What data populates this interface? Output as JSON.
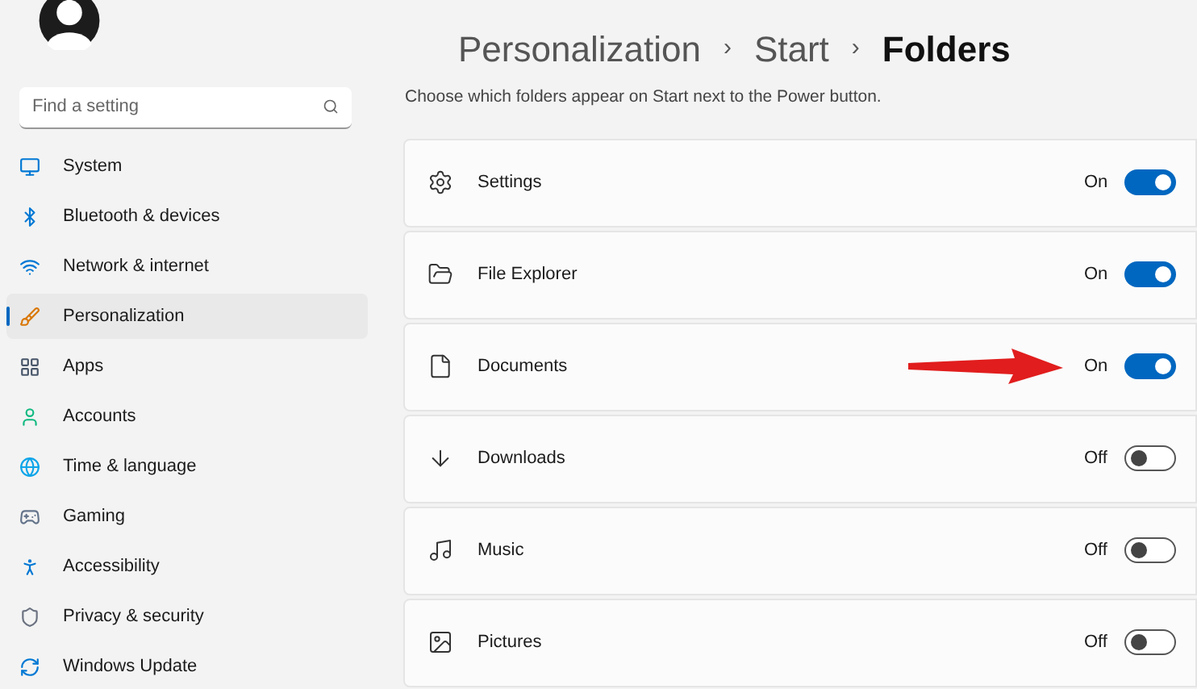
{
  "search": {
    "placeholder": "Find a setting"
  },
  "nav": [
    {
      "label": "System",
      "selected": false
    },
    {
      "label": "Bluetooth & devices",
      "selected": false
    },
    {
      "label": "Network & internet",
      "selected": false
    },
    {
      "label": "Personalization",
      "selected": true
    },
    {
      "label": "Apps",
      "selected": false
    },
    {
      "label": "Accounts",
      "selected": false
    },
    {
      "label": "Time & language",
      "selected": false
    },
    {
      "label": "Gaming",
      "selected": false
    },
    {
      "label": "Accessibility",
      "selected": false
    },
    {
      "label": "Privacy & security",
      "selected": false
    },
    {
      "label": "Windows Update",
      "selected": false
    }
  ],
  "breadcrumb": [
    "Personalization",
    "Start",
    "Folders"
  ],
  "separator": "›",
  "description": "Choose which folders appear on Start next to the Power button.",
  "folders": [
    {
      "label": "Settings",
      "on": true,
      "state": "On",
      "arrow": false
    },
    {
      "label": "File Explorer",
      "on": true,
      "state": "On",
      "arrow": false
    },
    {
      "label": "Documents",
      "on": true,
      "state": "On",
      "arrow": true
    },
    {
      "label": "Downloads",
      "on": false,
      "state": "Off",
      "arrow": false
    },
    {
      "label": "Music",
      "on": false,
      "state": "Off",
      "arrow": false
    },
    {
      "label": "Pictures",
      "on": false,
      "state": "Off",
      "arrow": false
    }
  ]
}
